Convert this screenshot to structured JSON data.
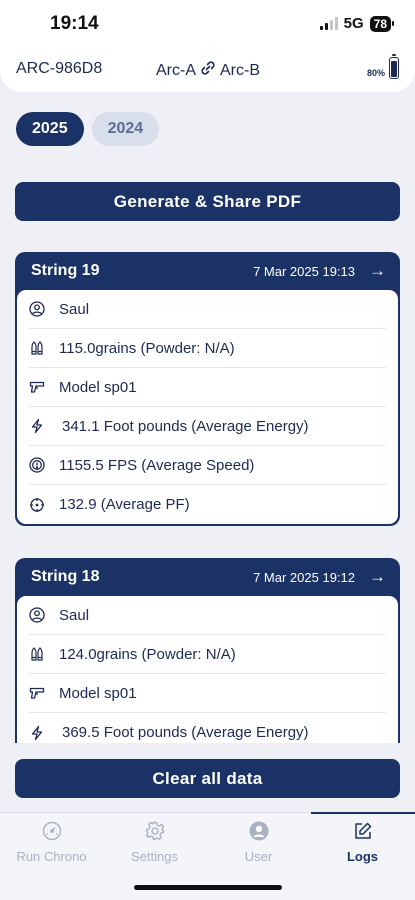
{
  "status_bar": {
    "time": "19:14",
    "network": "5G",
    "battery": "78"
  },
  "device_header": {
    "device_id": "ARC-986D8",
    "arc_a": "Arc-A",
    "arc_b": "Arc-B",
    "battery_pct": "80%",
    "battery_level": 0.8
  },
  "year_filter": {
    "years": [
      "2025",
      "2024"
    ],
    "selected": "2025"
  },
  "generate_pdf_label": "Generate & Share PDF",
  "strings": [
    {
      "title": "String 19",
      "datetime": "7 Mar 2025 19:13",
      "shooter": "Saul",
      "grains": "115.0grains (Powder: N/A)",
      "model": "Model sp01",
      "energy": "341.1 Foot pounds (Average Energy)",
      "speed": "1155.5 FPS (Average Speed)",
      "pf": "132.9 (Average PF)"
    },
    {
      "title": "String 18",
      "datetime": "7 Mar 2025 19:12",
      "shooter": "Saul",
      "grains": "124.0grains (Powder: N/A)",
      "model": "Model sp01",
      "energy": "369.5 Foot pounds (Average Energy)"
    }
  ],
  "clear_label": "Clear all data",
  "tabs": [
    {
      "label": "Run Chrono",
      "icon": "speedometer-icon"
    },
    {
      "label": "Settings",
      "icon": "gear-icon"
    },
    {
      "label": "User",
      "icon": "user-icon"
    },
    {
      "label": "Logs",
      "icon": "edit-icon"
    }
  ],
  "active_tab": "Logs",
  "colors": {
    "primary": "#1b3267",
    "background": "#eef0f5",
    "inactive": "#a9b1c3"
  }
}
